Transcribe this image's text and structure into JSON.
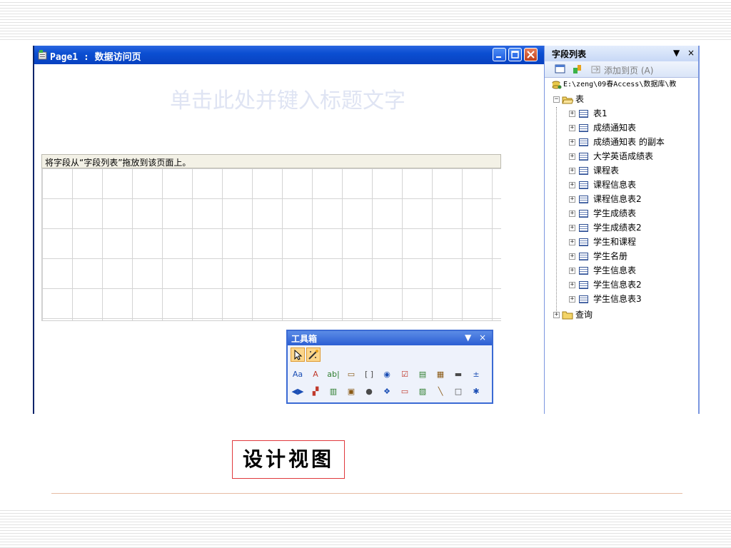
{
  "window": {
    "title": "Page1 : 数据访问页",
    "placeholder_title": "单击此处并键入标题文字",
    "section_header": "将字段从“字段列表”拖放到该页面上。"
  },
  "field_list": {
    "title": "字段列表",
    "dropdown_glyph": "▼",
    "close_glyph": "×",
    "add_to_page": "添加到页 (A)",
    "db_path": "E:\\zeng\\09春Access\\数据库\\教",
    "tables_label": "表",
    "tables": [
      "表1",
      "成绩通知表",
      "成绩通知表 的副本",
      "大学英语成绩表",
      "课程表",
      "课程信息表",
      "课程信息表2",
      "学生成绩表",
      "学生成绩表2",
      "学生和课程",
      "学生名册",
      "学生信息表",
      "学生信息表2",
      "学生信息表3"
    ],
    "queries_label": "查询"
  },
  "toolbox": {
    "title": "工具箱",
    "dropdown_glyph": "▼",
    "close_glyph": "×",
    "row2": [
      "Aa",
      "A",
      "ab|",
      "▭",
      "[ ]",
      "◉",
      "☑",
      "▤",
      "▦",
      "▬",
      "±"
    ],
    "row3": [
      "◀▶",
      "▞",
      "▥",
      "▣",
      "●",
      "❖",
      "▭",
      "▨",
      "╲",
      "□",
      "✱"
    ]
  },
  "caption": "设计视图",
  "colors": {
    "titlebar": "#0b4fd2",
    "caption_border": "#e0393d",
    "placeholder_text": "#dfe4f3"
  }
}
